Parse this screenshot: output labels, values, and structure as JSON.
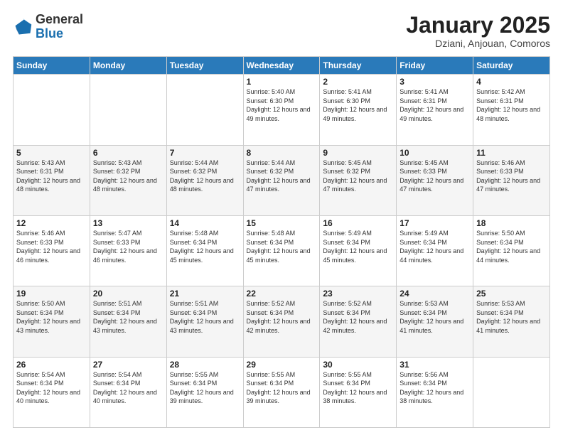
{
  "header": {
    "logo_general": "General",
    "logo_blue": "Blue",
    "title": "January 2025",
    "subtitle": "Dziani, Anjouan, Comoros"
  },
  "days_of_week": [
    "Sunday",
    "Monday",
    "Tuesday",
    "Wednesday",
    "Thursday",
    "Friday",
    "Saturday"
  ],
  "weeks": [
    [
      {
        "day": "",
        "sunrise": "",
        "sunset": "",
        "daylight": ""
      },
      {
        "day": "",
        "sunrise": "",
        "sunset": "",
        "daylight": ""
      },
      {
        "day": "",
        "sunrise": "",
        "sunset": "",
        "daylight": ""
      },
      {
        "day": "1",
        "sunrise": "Sunrise: 5:40 AM",
        "sunset": "Sunset: 6:30 PM",
        "daylight": "Daylight: 12 hours and 49 minutes."
      },
      {
        "day": "2",
        "sunrise": "Sunrise: 5:41 AM",
        "sunset": "Sunset: 6:30 PM",
        "daylight": "Daylight: 12 hours and 49 minutes."
      },
      {
        "day": "3",
        "sunrise": "Sunrise: 5:41 AM",
        "sunset": "Sunset: 6:31 PM",
        "daylight": "Daylight: 12 hours and 49 minutes."
      },
      {
        "day": "4",
        "sunrise": "Sunrise: 5:42 AM",
        "sunset": "Sunset: 6:31 PM",
        "daylight": "Daylight: 12 hours and 48 minutes."
      }
    ],
    [
      {
        "day": "5",
        "sunrise": "Sunrise: 5:43 AM",
        "sunset": "Sunset: 6:31 PM",
        "daylight": "Daylight: 12 hours and 48 minutes."
      },
      {
        "day": "6",
        "sunrise": "Sunrise: 5:43 AM",
        "sunset": "Sunset: 6:32 PM",
        "daylight": "Daylight: 12 hours and 48 minutes."
      },
      {
        "day": "7",
        "sunrise": "Sunrise: 5:44 AM",
        "sunset": "Sunset: 6:32 PM",
        "daylight": "Daylight: 12 hours and 48 minutes."
      },
      {
        "day": "8",
        "sunrise": "Sunrise: 5:44 AM",
        "sunset": "Sunset: 6:32 PM",
        "daylight": "Daylight: 12 hours and 47 minutes."
      },
      {
        "day": "9",
        "sunrise": "Sunrise: 5:45 AM",
        "sunset": "Sunset: 6:32 PM",
        "daylight": "Daylight: 12 hours and 47 minutes."
      },
      {
        "day": "10",
        "sunrise": "Sunrise: 5:45 AM",
        "sunset": "Sunset: 6:33 PM",
        "daylight": "Daylight: 12 hours and 47 minutes."
      },
      {
        "day": "11",
        "sunrise": "Sunrise: 5:46 AM",
        "sunset": "Sunset: 6:33 PM",
        "daylight": "Daylight: 12 hours and 47 minutes."
      }
    ],
    [
      {
        "day": "12",
        "sunrise": "Sunrise: 5:46 AM",
        "sunset": "Sunset: 6:33 PM",
        "daylight": "Daylight: 12 hours and 46 minutes."
      },
      {
        "day": "13",
        "sunrise": "Sunrise: 5:47 AM",
        "sunset": "Sunset: 6:33 PM",
        "daylight": "Daylight: 12 hours and 46 minutes."
      },
      {
        "day": "14",
        "sunrise": "Sunrise: 5:48 AM",
        "sunset": "Sunset: 6:34 PM",
        "daylight": "Daylight: 12 hours and 45 minutes."
      },
      {
        "day": "15",
        "sunrise": "Sunrise: 5:48 AM",
        "sunset": "Sunset: 6:34 PM",
        "daylight": "Daylight: 12 hours and 45 minutes."
      },
      {
        "day": "16",
        "sunrise": "Sunrise: 5:49 AM",
        "sunset": "Sunset: 6:34 PM",
        "daylight": "Daylight: 12 hours and 45 minutes."
      },
      {
        "day": "17",
        "sunrise": "Sunrise: 5:49 AM",
        "sunset": "Sunset: 6:34 PM",
        "daylight": "Daylight: 12 hours and 44 minutes."
      },
      {
        "day": "18",
        "sunrise": "Sunrise: 5:50 AM",
        "sunset": "Sunset: 6:34 PM",
        "daylight": "Daylight: 12 hours and 44 minutes."
      }
    ],
    [
      {
        "day": "19",
        "sunrise": "Sunrise: 5:50 AM",
        "sunset": "Sunset: 6:34 PM",
        "daylight": "Daylight: 12 hours and 43 minutes."
      },
      {
        "day": "20",
        "sunrise": "Sunrise: 5:51 AM",
        "sunset": "Sunset: 6:34 PM",
        "daylight": "Daylight: 12 hours and 43 minutes."
      },
      {
        "day": "21",
        "sunrise": "Sunrise: 5:51 AM",
        "sunset": "Sunset: 6:34 PM",
        "daylight": "Daylight: 12 hours and 43 minutes."
      },
      {
        "day": "22",
        "sunrise": "Sunrise: 5:52 AM",
        "sunset": "Sunset: 6:34 PM",
        "daylight": "Daylight: 12 hours and 42 minutes."
      },
      {
        "day": "23",
        "sunrise": "Sunrise: 5:52 AM",
        "sunset": "Sunset: 6:34 PM",
        "daylight": "Daylight: 12 hours and 42 minutes."
      },
      {
        "day": "24",
        "sunrise": "Sunrise: 5:53 AM",
        "sunset": "Sunset: 6:34 PM",
        "daylight": "Daylight: 12 hours and 41 minutes."
      },
      {
        "day": "25",
        "sunrise": "Sunrise: 5:53 AM",
        "sunset": "Sunset: 6:34 PM",
        "daylight": "Daylight: 12 hours and 41 minutes."
      }
    ],
    [
      {
        "day": "26",
        "sunrise": "Sunrise: 5:54 AM",
        "sunset": "Sunset: 6:34 PM",
        "daylight": "Daylight: 12 hours and 40 minutes."
      },
      {
        "day": "27",
        "sunrise": "Sunrise: 5:54 AM",
        "sunset": "Sunset: 6:34 PM",
        "daylight": "Daylight: 12 hours and 40 minutes."
      },
      {
        "day": "28",
        "sunrise": "Sunrise: 5:55 AM",
        "sunset": "Sunset: 6:34 PM",
        "daylight": "Daylight: 12 hours and 39 minutes."
      },
      {
        "day": "29",
        "sunrise": "Sunrise: 5:55 AM",
        "sunset": "Sunset: 6:34 PM",
        "daylight": "Daylight: 12 hours and 39 minutes."
      },
      {
        "day": "30",
        "sunrise": "Sunrise: 5:55 AM",
        "sunset": "Sunset: 6:34 PM",
        "daylight": "Daylight: 12 hours and 38 minutes."
      },
      {
        "day": "31",
        "sunrise": "Sunrise: 5:56 AM",
        "sunset": "Sunset: 6:34 PM",
        "daylight": "Daylight: 12 hours and 38 minutes."
      },
      {
        "day": "",
        "sunrise": "",
        "sunset": "",
        "daylight": ""
      }
    ]
  ]
}
